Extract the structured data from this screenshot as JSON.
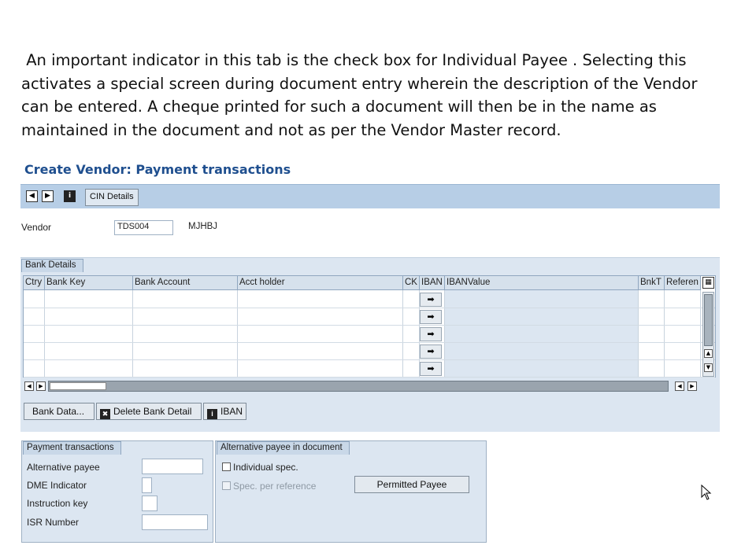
{
  "intro_lines": [
    " An important indicator in this tab is the check box for Individual Payee . Selecting this",
    "activates a special screen during document entry wherein the description of the Vendor",
    "can be entered. A cheque printed for such a document will then be in the name as",
    "maintained in the document and not as per the Vendor Master record."
  ],
  "window": {
    "title": "Create Vendor: Payment transactions"
  },
  "toolbar": {
    "cin_label": "CIN Details"
  },
  "vendor": {
    "label": "Vendor",
    "id": "TDS004",
    "name": "MJHBJ"
  },
  "bank_details": {
    "tab_label": "Bank Details",
    "columns": [
      "Ctry",
      "Bank Key",
      "Bank Account",
      "Acct holder",
      "CK",
      "IBAN",
      "IBANValue",
      "BnkT",
      "Referen"
    ],
    "row_count": 5,
    "iban_arrow": "➡"
  },
  "buttons": {
    "bank_data": "Bank Data...",
    "delete_bank_detail": "Delete Bank Detail",
    "iban": "IBAN"
  },
  "payment_transactions": {
    "tab_label": "Payment transactions",
    "fields": [
      {
        "label": "Alternative payee",
        "value": ""
      },
      {
        "label": "DME Indicator",
        "value": ""
      },
      {
        "label": "Instruction key",
        "value": ""
      },
      {
        "label": "ISR Number",
        "value": ""
      }
    ]
  },
  "alternative_payee": {
    "tab_label": "Alternative payee in document",
    "individual_spec": "Individual spec.",
    "spec_per_reference": "Spec. per reference",
    "permitted_payee_button": "Permitted Payee"
  },
  "colors": {
    "title": "#1f4f8f",
    "toolbar": "#b7cee6",
    "section": "#dce6f1"
  }
}
